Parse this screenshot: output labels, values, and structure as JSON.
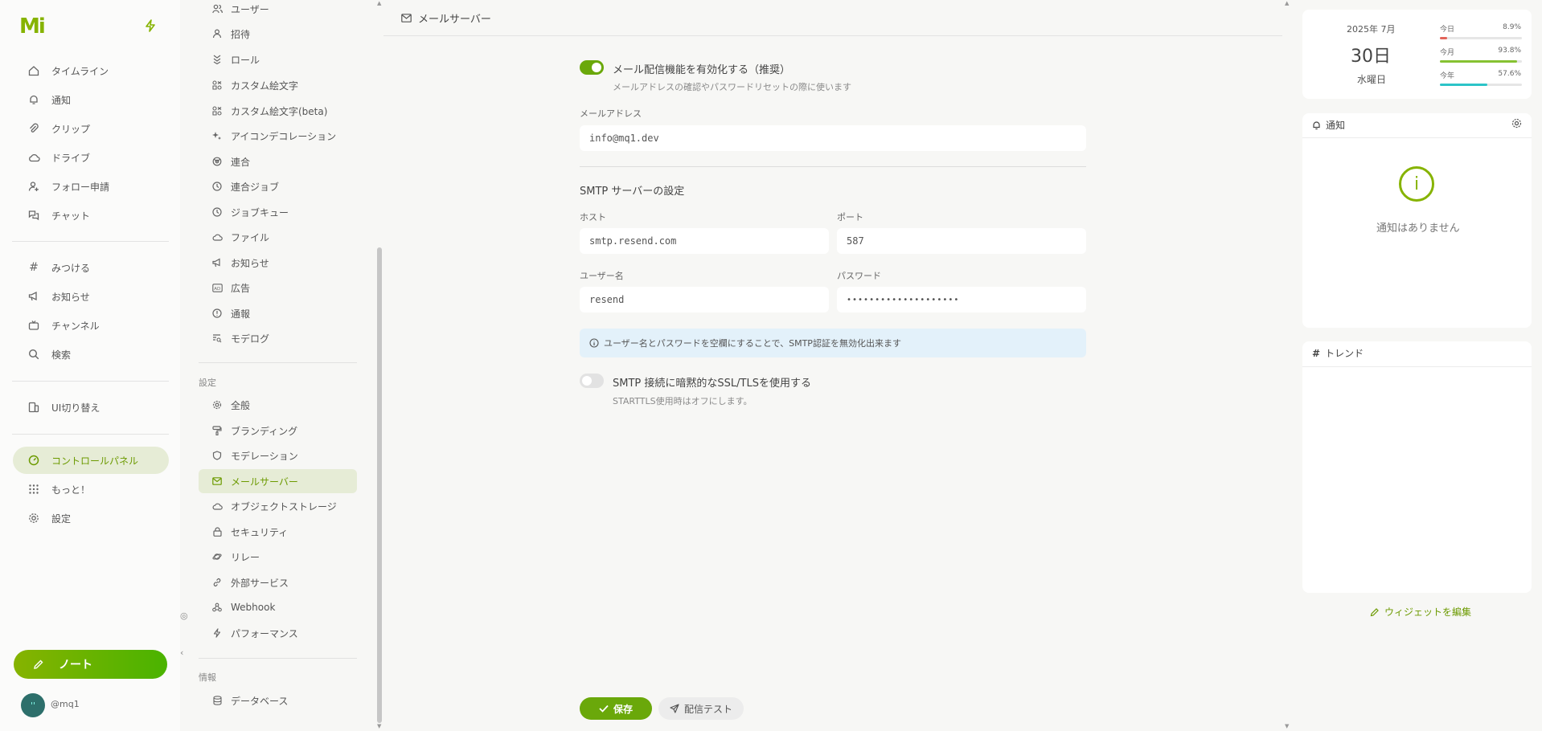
{
  "app": {
    "logo": "Mi"
  },
  "nav": {
    "items": [
      {
        "label": "タイムライン",
        "icon": "home-icon"
      },
      {
        "label": "通知",
        "icon": "bell-icon"
      },
      {
        "label": "クリップ",
        "icon": "paperclip-icon"
      },
      {
        "label": "ドライブ",
        "icon": "cloud-icon"
      },
      {
        "label": "フォロー申請",
        "icon": "user-plus-icon"
      },
      {
        "label": "チャット",
        "icon": "chat-icon"
      },
      {
        "label": "みつける",
        "icon": "hash-icon"
      },
      {
        "label": "お知らせ",
        "icon": "megaphone-icon"
      },
      {
        "label": "チャンネル",
        "icon": "tv-icon"
      },
      {
        "label": "検索",
        "icon": "search-icon"
      },
      {
        "label": "UI切り替え",
        "icon": "device-icon"
      },
      {
        "label": "コントロールパネル",
        "icon": "gauge-icon"
      },
      {
        "label": "もっと！",
        "icon": "grid-dots-icon"
      },
      {
        "label": "設定",
        "icon": "gear-icon"
      }
    ],
    "note_button": "ノート",
    "user": {
      "handle": "@mq1",
      "avatar_text": "''"
    }
  },
  "menu": {
    "items": [
      {
        "label": "ユーザー"
      },
      {
        "label": "招待"
      },
      {
        "label": "ロール"
      },
      {
        "label": "カスタム絵文字"
      },
      {
        "label": "カスタム絵文字(beta)"
      },
      {
        "label": "アイコンデコレーション"
      },
      {
        "label": "連合"
      },
      {
        "label": "連合ジョブ"
      },
      {
        "label": "ジョブキュー"
      },
      {
        "label": "ファイル"
      },
      {
        "label": "お知らせ"
      },
      {
        "label": "広告"
      },
      {
        "label": "通報"
      },
      {
        "label": "モデログ"
      }
    ],
    "settings_category": "設定",
    "settings_items": [
      {
        "label": "全般"
      },
      {
        "label": "ブランディング"
      },
      {
        "label": "モデレーション"
      },
      {
        "label": "メールサーバー"
      },
      {
        "label": "オブジェクトストレージ"
      },
      {
        "label": "セキュリティ"
      },
      {
        "label": "リレー"
      },
      {
        "label": "外部サービス"
      },
      {
        "label": "Webhook"
      },
      {
        "label": "パフォーマンス"
      }
    ],
    "info_category": "情報",
    "info_items": [
      {
        "label": "データベース"
      }
    ]
  },
  "main": {
    "title": "メールサーバー",
    "enable_label": "メール配信機能を有効化する（推奨）",
    "enable_caption": "メールアドレスの確認やパスワードリセットの際に使います",
    "enable_on": true,
    "email_label": "メールアドレス",
    "email_value": "info@mq1.dev",
    "smtp_title": "SMTP サーバーの設定",
    "host_label": "ホスト",
    "host_value": "smtp.resend.com",
    "port_label": "ポート",
    "port_value": "587",
    "username_label": "ユーザー名",
    "username_value": "resend",
    "password_label": "パスワード",
    "password_value": "••••••••••••••••••••",
    "info_text": "ユーザー名とパスワードを空欄にすることで、SMTP認証を無効化出来ます",
    "ssl_label": "SMTP 接続に暗黙的なSSL/TLSを使用する",
    "ssl_caption": "STARTTLS使用時はオフにします。",
    "ssl_on": false,
    "save_button": "保存",
    "test_button": "配信テスト"
  },
  "widgets": {
    "calendar": {
      "year_month": "2025年 7月",
      "day": "30日",
      "weekday": "水曜日",
      "stats": [
        {
          "label": "今日",
          "value": "8.9%",
          "fraction": 0.089,
          "color": "#e3645a"
        },
        {
          "label": "今月",
          "value": "93.8%",
          "fraction": 0.938,
          "color": "#86c232"
        },
        {
          "label": "今年",
          "value": "57.6%",
          "fraction": 0.576,
          "color": "#2cc4c8"
        }
      ]
    },
    "notifications": {
      "title": "通知",
      "empty": "通知はありません"
    },
    "trends": {
      "title": "トレンド"
    },
    "edit_label": "ウィジェットを編集"
  },
  "colors": {
    "accent": "#86b300",
    "active_bg": "#e6ecd6",
    "info_bg": "#e3f1fa"
  }
}
